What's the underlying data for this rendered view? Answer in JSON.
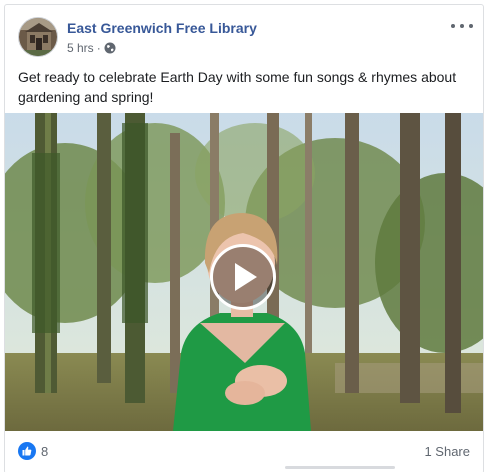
{
  "post": {
    "page_name": "East Greenwich Free Library",
    "timestamp": "5 hrs",
    "separator": "·",
    "privacy_icon": "globe-icon",
    "more_icon": "more-options-icon",
    "message": "Get ready to celebrate Earth Day with some fun songs & rhymes about gardening and spring!",
    "video": {
      "play_icon": "play-icon"
    }
  },
  "footer": {
    "reaction_icon": "like-icon",
    "reaction_count": "8",
    "shares": "1 Share"
  },
  "colors": {
    "link": "#385898",
    "accent": "#1877f2",
    "secondary_text": "#606770"
  }
}
